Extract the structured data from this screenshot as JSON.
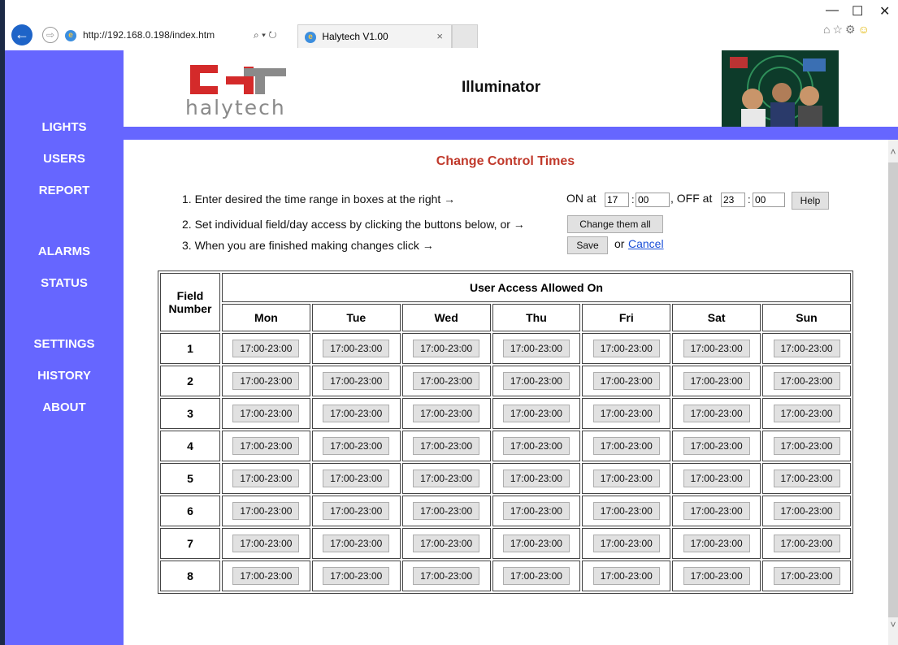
{
  "browser": {
    "url": "http://192.168.0.198/index.htm",
    "tab_title": "Halytech V1.00",
    "address_tools": "⌕ ▾ ↻",
    "tab_close": "×",
    "minimize": "—",
    "maximize": "☐",
    "close": "✕",
    "icons": [
      "home-icon",
      "favorites-icon",
      "settings-icon",
      "smiley-icon"
    ]
  },
  "site": {
    "logo_text": "halytech",
    "title": "Illuminator"
  },
  "nav": {
    "items": [
      {
        "label": "LIGHTS"
      },
      {
        "label": "USERS"
      },
      {
        "label": "REPORT"
      },
      {
        "label": "ALARMS"
      },
      {
        "label": "STATUS"
      },
      {
        "label": "SETTINGS"
      },
      {
        "label": "HISTORY"
      },
      {
        "label": "ABOUT"
      }
    ]
  },
  "page": {
    "heading": "Change Control Times",
    "step1": "1. Enter desired the time range in boxes at the right →",
    "step2": "2. Set individual field/day access by clicking the buttons below, or →",
    "step3": "3. When you are finished making changes click →",
    "on_label": "ON at",
    "off_label": ", OFF at",
    "on_hour": "17",
    "on_min": "00",
    "off_hour": "23",
    "off_min": "00",
    "colon": ":",
    "help_button": "Help",
    "change_all_button": "Change them all",
    "save_button": "Save",
    "or_text": "or",
    "cancel_link": "Cancel"
  },
  "table": {
    "field_header": "Field Number",
    "access_header": "User Access Allowed On",
    "days": [
      "Mon",
      "Tue",
      "Wed",
      "Thu",
      "Fri",
      "Sat",
      "Sun"
    ],
    "rows": [
      {
        "field": "1",
        "times": [
          "17:00-23:00",
          "17:00-23:00",
          "17:00-23:00",
          "17:00-23:00",
          "17:00-23:00",
          "17:00-23:00",
          "17:00-23:00"
        ]
      },
      {
        "field": "2",
        "times": [
          "17:00-23:00",
          "17:00-23:00",
          "17:00-23:00",
          "17:00-23:00",
          "17:00-23:00",
          "17:00-23:00",
          "17:00-23:00"
        ]
      },
      {
        "field": "3",
        "times": [
          "17:00-23:00",
          "17:00-23:00",
          "17:00-23:00",
          "17:00-23:00",
          "17:00-23:00",
          "17:00-23:00",
          "17:00-23:00"
        ]
      },
      {
        "field": "4",
        "times": [
          "17:00-23:00",
          "17:00-23:00",
          "17:00-23:00",
          "17:00-23:00",
          "17:00-23:00",
          "17:00-23:00",
          "17:00-23:00"
        ]
      },
      {
        "field": "5",
        "times": [
          "17:00-23:00",
          "17:00-23:00",
          "17:00-23:00",
          "17:00-23:00",
          "17:00-23:00",
          "17:00-23:00",
          "17:00-23:00"
        ]
      },
      {
        "field": "6",
        "times": [
          "17:00-23:00",
          "17:00-23:00",
          "17:00-23:00",
          "17:00-23:00",
          "17:00-23:00",
          "17:00-23:00",
          "17:00-23:00"
        ]
      },
      {
        "field": "7",
        "times": [
          "17:00-23:00",
          "17:00-23:00",
          "17:00-23:00",
          "17:00-23:00",
          "17:00-23:00",
          "17:00-23:00",
          "17:00-23:00"
        ]
      },
      {
        "field": "8",
        "times": [
          "17:00-23:00",
          "17:00-23:00",
          "17:00-23:00",
          "17:00-23:00",
          "17:00-23:00",
          "17:00-23:00",
          "17:00-23:00"
        ]
      }
    ]
  },
  "colors": {
    "nav_blue": "#6666ff",
    "heading_red": "#c0392b",
    "logo_red": "#d42a2a",
    "logo_gray": "#8a8a8a"
  }
}
